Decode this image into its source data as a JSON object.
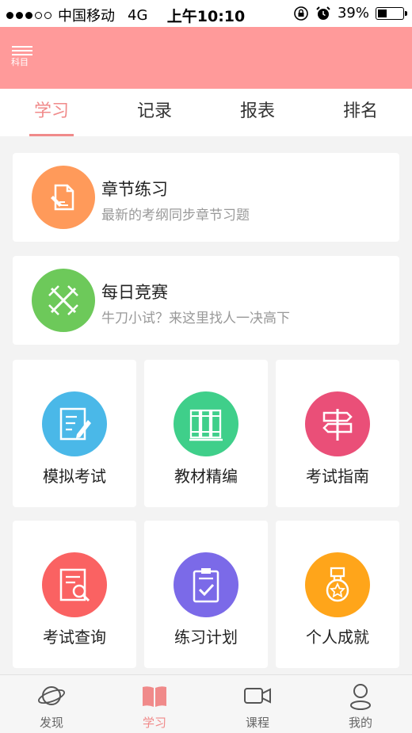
{
  "status_bar": {
    "carrier": "中国移动",
    "network": "4G",
    "time": "上午10:10",
    "battery": "39%",
    "battery_level": 0.39
  },
  "header": {
    "subject_label": "科目",
    "bg_color": "#ff9a9a"
  },
  "tabs": [
    {
      "label": "学习",
      "active": true
    },
    {
      "label": "记录"
    },
    {
      "label": "报表"
    },
    {
      "label": "排名"
    }
  ],
  "features": [
    {
      "title": "章节练习",
      "subtitle": "最新的考纲同步章节习题",
      "icon": "document-edit-icon",
      "color": "#ff9a5a"
    },
    {
      "title": "每日竞赛",
      "subtitle": "牛刀小试？来这里找人一决高下",
      "icon": "crossed-swords-icon",
      "color": "#6dc95a"
    }
  ],
  "grid": [
    {
      "label": "模拟考试",
      "icon": "exam-edit-icon",
      "color": "#4ab8e8"
    },
    {
      "label": "教材精编",
      "icon": "books-icon",
      "color": "#3fcf8a"
    },
    {
      "label": "考试指南",
      "icon": "signpost-icon",
      "color": "#ea4f78"
    },
    {
      "label": "考试查询",
      "icon": "search-doc-icon",
      "color": "#fa6262"
    },
    {
      "label": "练习计划",
      "icon": "clipboard-check-icon",
      "color": "#7b6ae8"
    },
    {
      "label": "个人成就",
      "icon": "medal-icon",
      "color": "#ffa51a"
    }
  ],
  "bottom_nav": [
    {
      "label": "发现",
      "icon": "planet-icon"
    },
    {
      "label": "学习",
      "icon": "open-book-icon",
      "active": true
    },
    {
      "label": "课程",
      "icon": "video-camera-icon"
    },
    {
      "label": "我的",
      "icon": "user-icon"
    }
  ],
  "accent_color": "#f08a8a"
}
